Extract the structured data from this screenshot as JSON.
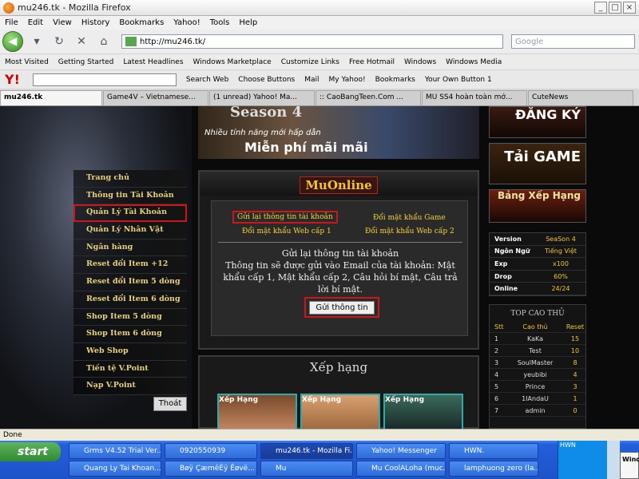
{
  "browser": {
    "title": "mu246.tk - Mozilla Firefox",
    "menu": [
      "File",
      "Edit",
      "View",
      "History",
      "Bookmarks",
      "Yahoo!",
      "Tools",
      "Help"
    ],
    "url": "http://mu246.tk/",
    "search_placeholder": "Google",
    "bookmarks": [
      "Most Visited",
      "Getting Started",
      "Latest Headlines",
      "Windows Marketplace",
      "Customize Links",
      "Free Hotmail",
      "Windows",
      "Windows Media"
    ],
    "yahoo_toolbar": [
      "Search Web",
      "Choose Buttons",
      "Mail",
      "My Yahoo!",
      "Bookmarks",
      "Your Own Button 1"
    ],
    "tabs": [
      "mu246.tk",
      "Game4V – Vietnamese...",
      "(1 unread) Yahoo! Ma...",
      ":: CaoBangTeen.Com ...",
      "MU SS4 hoàn toàn mớ...",
      "CuteNews"
    ],
    "status": "Done"
  },
  "site": {
    "banner": {
      "line1": "Season 4",
      "line2": "Nhiều tính năng mới hấp dẫn",
      "line3": "Miễn phí mãi mãi"
    },
    "left_menu": [
      "Trang chủ",
      "Thông tin Tài Khoản",
      "Quản Lý Tài Khoản",
      "Quản Lý Nhân Vật",
      "Ngân hàng",
      "Reset đổi Item +12",
      "Reset đổi Item 5 dòng",
      "Reset đổi Item 6 dòng",
      "Shop Item 5 dòng",
      "Shop Item 6 dòng",
      "Web Shop",
      "Tiền tệ V.Point",
      "Nạp V.Point"
    ],
    "logout": "Thoát",
    "main_header": "MuOnline",
    "links": {
      "resend": "Gửi lại thông tin tài khoản",
      "change_game_pw": "Đổi mật khẩu Game",
      "change_web_pw1": "Đổi mật khẩu Web cấp 1",
      "change_web_pw2": "Đổi mật khẩu Web cấp 2"
    },
    "desc_title": "Gửi lại thông tin tài khoản",
    "desc_body": "Thông tin sẽ được gửi vào Email của tài khoản: Mật khẩu cấp 1, Mật khẩu cấp 2, Câu hỏi bí mật, Câu trả lời bí mật.",
    "send_button": "Gửi thông tin",
    "ranking_header": "Xếp hạng",
    "thumb_labels": [
      "Xếp Hạng",
      "Xếp Hạng",
      "Xếp Hạng"
    ],
    "right_buttons": [
      "ĐĂNG KÝ",
      "Tải GAME",
      "Bảng Xếp Hạng"
    ],
    "server_info": [
      {
        "k": "Version",
        "v": "SeaSon 4"
      },
      {
        "k": "Ngôn Ngữ",
        "v": "Tiếng Việt"
      },
      {
        "k": "Exp",
        "v": "x100"
      },
      {
        "k": "Drop",
        "v": "60%"
      },
      {
        "k": "Online",
        "v": "24/24"
      }
    ],
    "top_title": "TOP CAO THỦ",
    "top_headers": [
      "Stt",
      "Cao thủ",
      "Reset"
    ],
    "top_rows": [
      {
        "stt": "1",
        "name": "KaKa",
        "reset": "15"
      },
      {
        "stt": "2",
        "name": "Test",
        "reset": "10"
      },
      {
        "stt": "3",
        "name": "SoulMaster",
        "reset": "8"
      },
      {
        "stt": "4",
        "name": "yeubibi",
        "reset": "4"
      },
      {
        "stt": "5",
        "name": "Prince",
        "reset": "3"
      },
      {
        "stt": "6",
        "name": "1IAndaU",
        "reset": "1"
      },
      {
        "stt": "7",
        "name": "admin",
        "reset": "0"
      }
    ]
  },
  "taskbar": {
    "start": "start",
    "row1": [
      "Grms V4.52 Trial Ver...",
      "0920550939",
      "mu246.tk - Mozilla Fi...",
      "Yahoo! Messenger",
      "HWN."
    ],
    "row2": [
      "Quang Ly Tai Khoan...",
      "Bøÿ ÇæmêÉÿ Êøvë...",
      "Mu",
      "Mu CoolALoha (muc...",
      "lamphuong zero (la..."
    ],
    "tray_text": "HWN",
    "yahoo_popup": "Windo"
  }
}
